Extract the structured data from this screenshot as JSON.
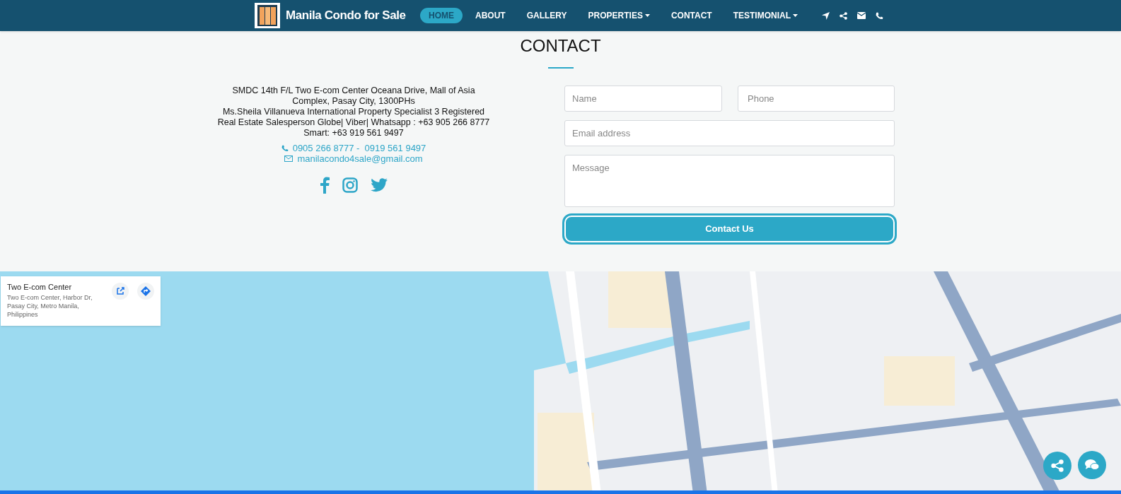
{
  "header": {
    "logo_text": "Manila Condo for Sale",
    "nav": [
      {
        "label": "HOME",
        "selected": true,
        "dropdown": false
      },
      {
        "label": "ABOUT",
        "selected": false,
        "dropdown": false
      },
      {
        "label": "GALLERY",
        "selected": false,
        "dropdown": false
      },
      {
        "label": "PROPERTIES",
        "selected": false,
        "dropdown": true
      },
      {
        "label": "CONTACT",
        "selected": false,
        "dropdown": false
      },
      {
        "label": "TESTIMONIAL",
        "selected": false,
        "dropdown": true
      }
    ]
  },
  "contact": {
    "title": "CONTACT",
    "address": "SMDC 14th F/L Two E-com Center Oceana Drive, Mall of Asia Complex, Pasay City, 1300PHs",
    "agent": "Ms.Sheila Villanueva International Property Specialist 3 Registered Real Estate Salesperson Globe| Viber| Whatsapp : +63 905 266 8777 Smart: +63 919 561 9497",
    "phone": "0905 266 8777 -  0919 561 9497",
    "email": "manilacondo4sale@gmail.com"
  },
  "form": {
    "name": {
      "placeholder": "Name"
    },
    "phone": {
      "placeholder": "Phone"
    },
    "email": {
      "placeholder": "Email address"
    },
    "message": {
      "placeholder": "Message"
    },
    "submit": "Contact Us"
  },
  "map": {
    "kind": "picture",
    "card": {
      "title": "Two E-com Center",
      "address": "Two E-com Center, Harbor Dr, Pasay City, Metro Manila, Philippines"
    }
  }
}
